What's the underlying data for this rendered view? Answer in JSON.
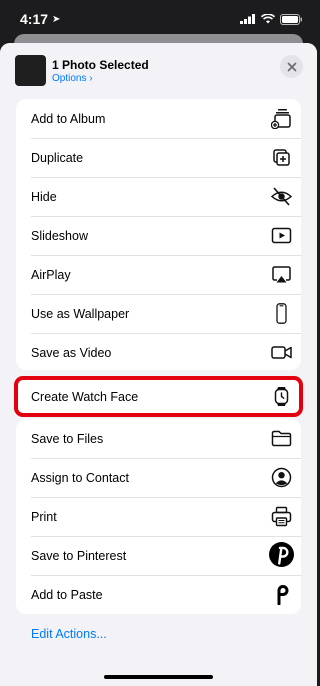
{
  "status": {
    "time": "4:17"
  },
  "header": {
    "title": "1 Photo Selected",
    "options_label": "Options",
    "options_chevron": "›"
  },
  "group1": [
    {
      "label": "Add to Album",
      "icon": "add-to-album-icon"
    },
    {
      "label": "Duplicate",
      "icon": "duplicate-icon"
    },
    {
      "label": "Hide",
      "icon": "hide-eye-icon"
    },
    {
      "label": "Slideshow",
      "icon": "slideshow-play-icon"
    },
    {
      "label": "AirPlay",
      "icon": "airplay-icon"
    },
    {
      "label": "Use as Wallpaper",
      "icon": "phone-wallpaper-icon"
    },
    {
      "label": "Save as Video",
      "icon": "video-camera-icon"
    }
  ],
  "highlighted": {
    "label": "Create Watch Face",
    "icon": "watch-icon",
    "outline_color": "#e3000f"
  },
  "group2": [
    {
      "label": "Save to Files",
      "icon": "folder-icon"
    },
    {
      "label": "Assign to Contact",
      "icon": "contact-icon"
    },
    {
      "label": "Print",
      "icon": "printer-icon"
    },
    {
      "label": "Save to Pinterest",
      "icon": "pinterest-icon"
    },
    {
      "label": "Add to Paste",
      "icon": "paste-app-icon"
    }
  ],
  "footer": {
    "edit_actions": "Edit Actions..."
  },
  "colors": {
    "accent": "#007aff",
    "sheet": "#f2f2f7",
    "row": "#ffffff"
  }
}
